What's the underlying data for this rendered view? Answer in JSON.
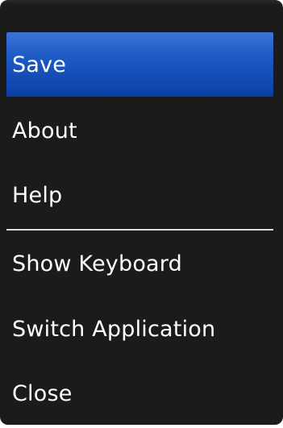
{
  "menu": {
    "items": [
      {
        "label": "Save",
        "selected": true
      },
      {
        "label": "About",
        "selected": false
      },
      {
        "label": "Help",
        "selected": false
      },
      {
        "label": "Show Keyboard",
        "selected": false
      },
      {
        "label": "Switch Application",
        "selected": false
      },
      {
        "label": "Close",
        "selected": false
      }
    ],
    "colors": {
      "background": "#1b1b1b",
      "selected_highlight": "#1f5cc7",
      "text": "#ffffff",
      "divider": "#d9d9d9"
    }
  }
}
